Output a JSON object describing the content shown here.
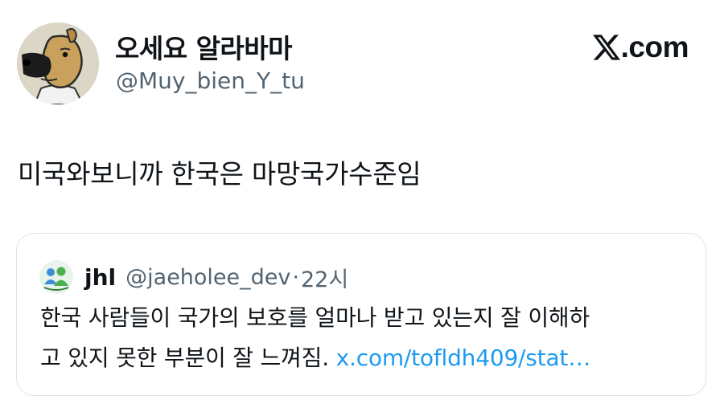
{
  "author": {
    "display_name": "오세요 알라바마",
    "handle": "@Muy_bien_Y_tu",
    "avatar_icon": "cartoon-dog-avatar-icon"
  },
  "brand": {
    "label": ".com",
    "logo_icon": "x-logo-icon"
  },
  "tweet": {
    "text": "미국와보니까 한국은 마망국가수준임"
  },
  "quote": {
    "name": "jhl",
    "handle": "@jaeholee_dev",
    "separator": "·",
    "time": "22시",
    "avatar_icon": "messenger-people-avatar-icon",
    "line1": "한국 사람들이 국가의 보호를 얼마나 받고 있는지 잘 이해하",
    "line2_text": "고 있지 못한 부분이 잘 느껴짐.",
    "link": "x.com/tofldh409/stat…"
  },
  "colors": {
    "link": "#1d9bf0",
    "secondary_text": "#536471",
    "border": "#dfe3e7"
  }
}
